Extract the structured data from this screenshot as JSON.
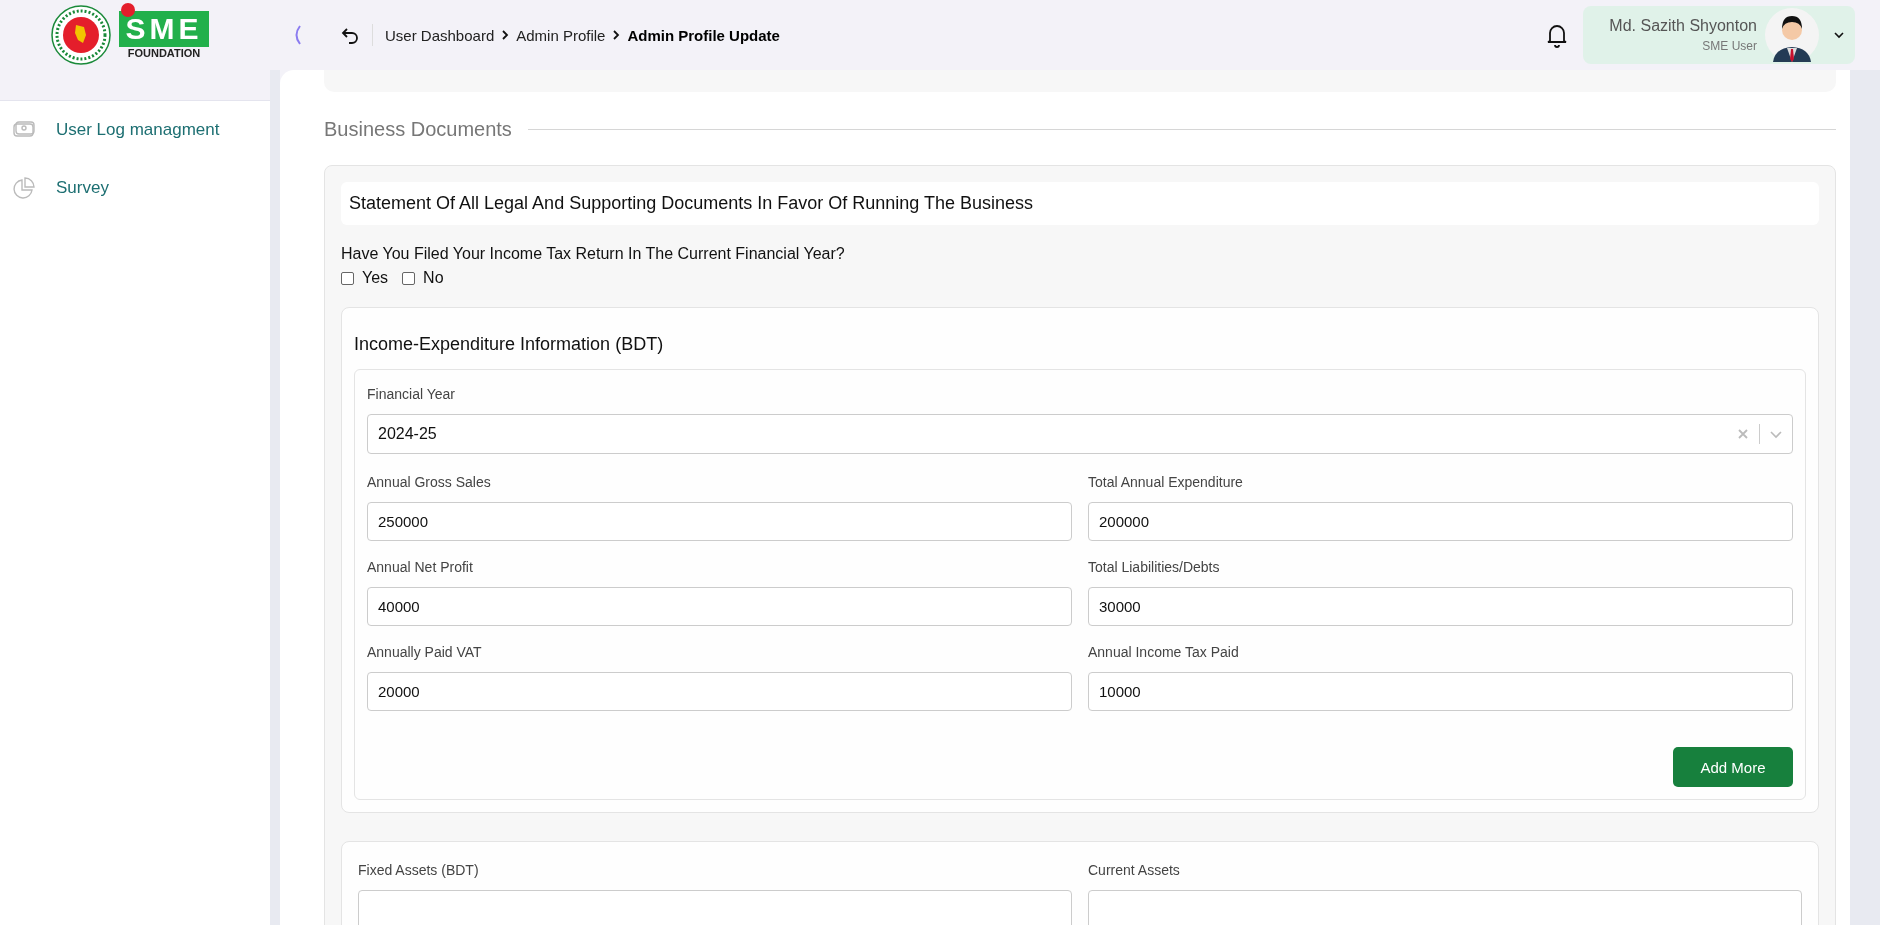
{
  "logo": {
    "mark": "SME",
    "subtitle": "FOUNDATION"
  },
  "sidebar": {
    "items": [
      {
        "label": "User Log managment",
        "kind": "log"
      },
      {
        "label": "Survey",
        "kind": "survey"
      }
    ]
  },
  "breadcrumb": [
    {
      "label": "User Dashboard",
      "current": false
    },
    {
      "label": "Admin Profile",
      "current": false
    },
    {
      "label": "Admin Profile Update",
      "current": true
    }
  ],
  "user": {
    "name": "Md. Sazith Shyonton",
    "role": "SME User"
  },
  "section_title": "Business Documents",
  "statement": "Statement Of All Legal And Supporting Documents In Favor Of Running The Business",
  "question": {
    "text": "Have You Filed Your Income Tax Return In The Current Financial Year?",
    "options": [
      {
        "label": "Yes",
        "checked": false
      },
      {
        "label": "No",
        "checked": false
      }
    ]
  },
  "income": {
    "title": "Income-Expenditure Information (BDT)",
    "financial_year": {
      "label": "Financial Year",
      "value": "2024-25"
    },
    "fields": [
      {
        "label": "Annual Gross Sales",
        "value": "250000"
      },
      {
        "label": "Total Annual Expenditure",
        "value": "200000"
      },
      {
        "label": "Annual Net Profit",
        "value": "40000"
      },
      {
        "label": "Total Liabilities/Debts",
        "value": "30000"
      },
      {
        "label": "Annually Paid VAT",
        "value": "20000"
      },
      {
        "label": "Annual Income Tax Paid",
        "value": "10000"
      }
    ],
    "button": "Add More"
  },
  "assets": {
    "fields": [
      {
        "label": "Fixed Assets (BDT)"
      },
      {
        "label": "Current Assets"
      }
    ]
  }
}
